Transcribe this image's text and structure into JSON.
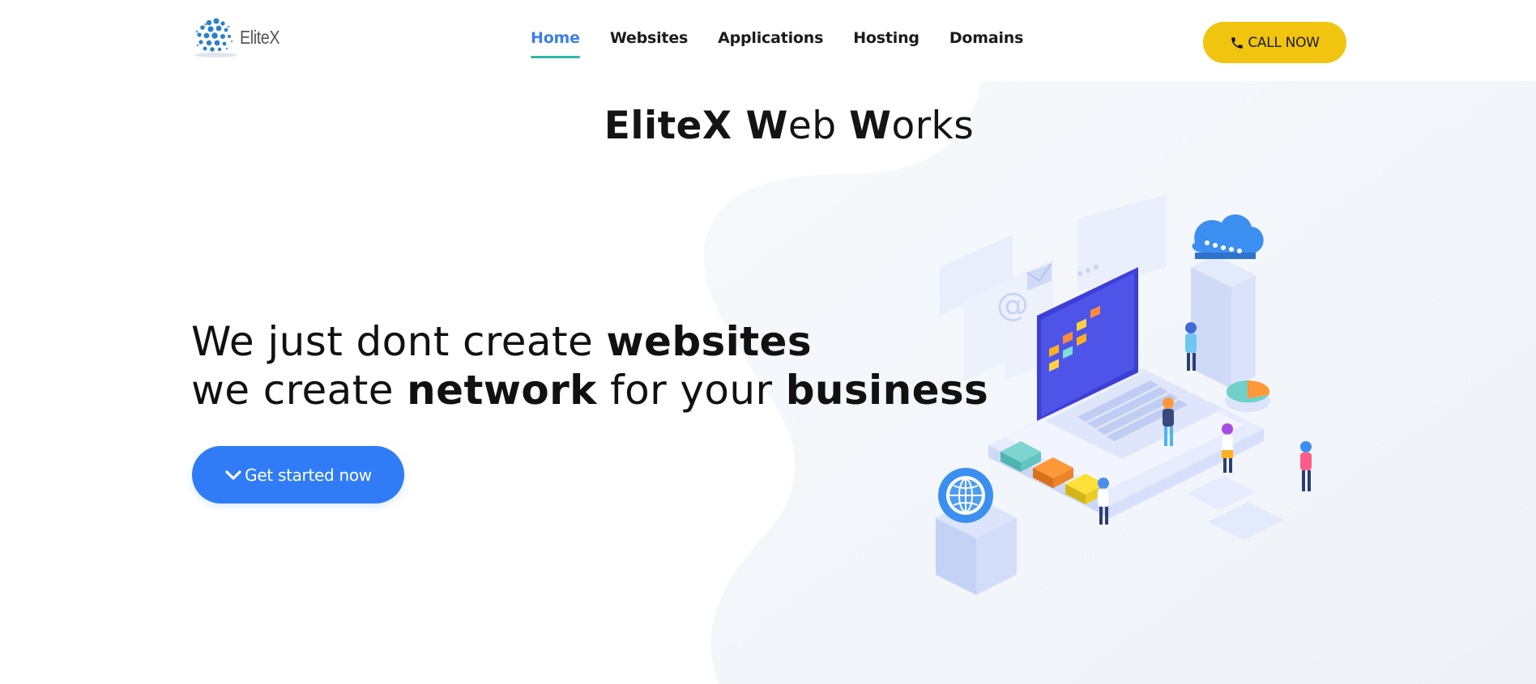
{
  "logo": {
    "text": "EliteX"
  },
  "nav": {
    "items": [
      {
        "label": "Home",
        "active": true
      },
      {
        "label": "Websites",
        "active": false
      },
      {
        "label": "Applications",
        "active": false
      },
      {
        "label": "Hosting",
        "active": false
      },
      {
        "label": "Domains",
        "active": false
      }
    ]
  },
  "call_button": {
    "label": "CALL NOW",
    "icon": "phone-icon"
  },
  "brand": {
    "part1_bold": "EliteX W",
    "part2_light": "eb ",
    "part3_bold": "W",
    "part4_light": "orks"
  },
  "hero": {
    "line1_light": "We just dont create ",
    "line1_bold": "websites",
    "line2_light_a": "we create ",
    "line2_bold_a": "network",
    "line2_light_b": " for your ",
    "line2_bold_b": "business"
  },
  "cta": {
    "label": "Get started now",
    "icon": "chevron-down-icon"
  },
  "colors": {
    "accent_blue": "#2f7cf6",
    "nav_active": "#3f7fe6",
    "nav_underline": "#2bb8a8",
    "call_yellow": "#f1c40f"
  }
}
